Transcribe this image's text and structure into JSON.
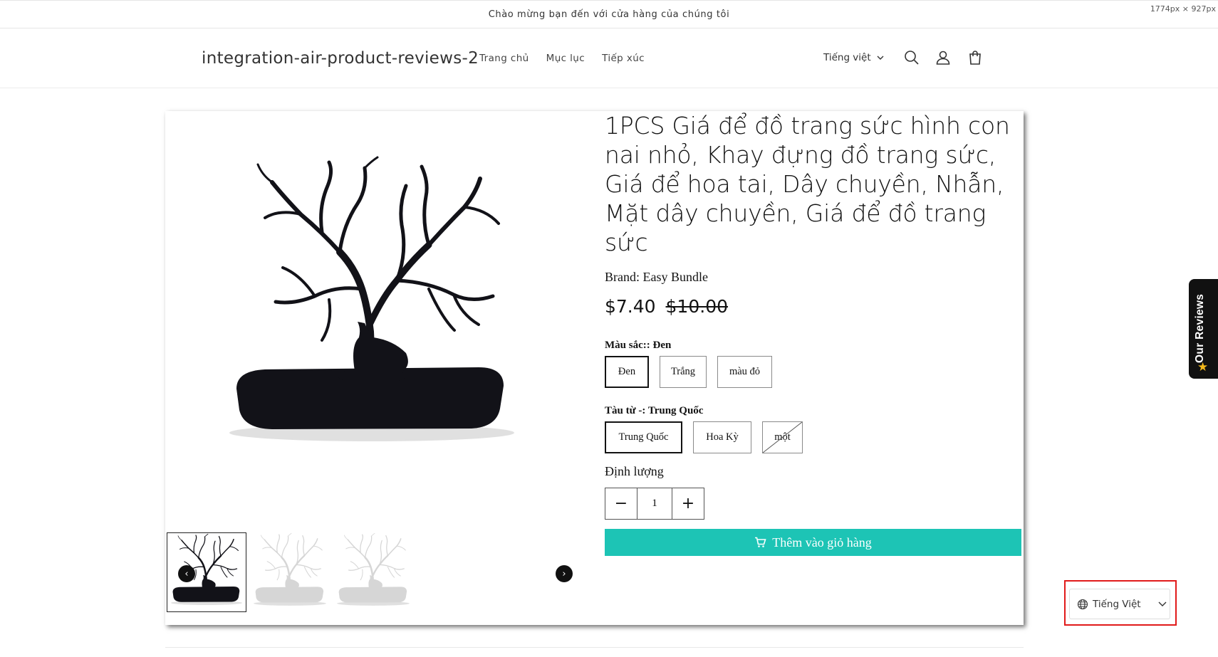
{
  "announcement": "Chào mừng bạn đến với cửa hàng của chúng tôi",
  "viewport_label": "1774px × 927px",
  "header": {
    "site_title": "integration-air-product-reviews-2",
    "nav": [
      "Trang chủ",
      "Mục lục",
      "Tiếp xúc"
    ],
    "language": "Tiếng việt",
    "icons": [
      "search-icon",
      "account-icon",
      "cart-icon"
    ]
  },
  "product": {
    "title": "1PCS Giá để đồ trang sức hình con nai nhỏ, Khay đựng đồ trang sức, Giá để hoa tai, Dây chuyền, Nhẫn, Mặt dây chuyền, Giá để đồ trang sức",
    "brand": "Brand: Easy Bundle",
    "price": "$7.40",
    "compare_price": "$10.00",
    "option1": {
      "label": "Màu sắc:: Đen",
      "values": [
        "Đen",
        "Trắng",
        "màu đỏ"
      ],
      "selected": "Đen"
    },
    "option2": {
      "label": "Tàu từ -: Trung Quốc",
      "values": [
        "Trung Quốc",
        "Hoa Kỳ",
        "một"
      ],
      "selected": "Trung Quốc",
      "unavailable": [
        "một"
      ]
    },
    "quantity_label": "Định lượng",
    "quantity": "1",
    "add_to_cart": "Thêm vào giỏ hàng",
    "images": [
      "black",
      "white",
      "white"
    ]
  },
  "reviews_tab": "Our Reviews",
  "language_switcher": "Tiếng Việt",
  "colors": {
    "accent": "#1dc4b5",
    "highlight": "#e11a1a",
    "reviews_tab_bg": "#111111",
    "star": "#f3b81b"
  }
}
